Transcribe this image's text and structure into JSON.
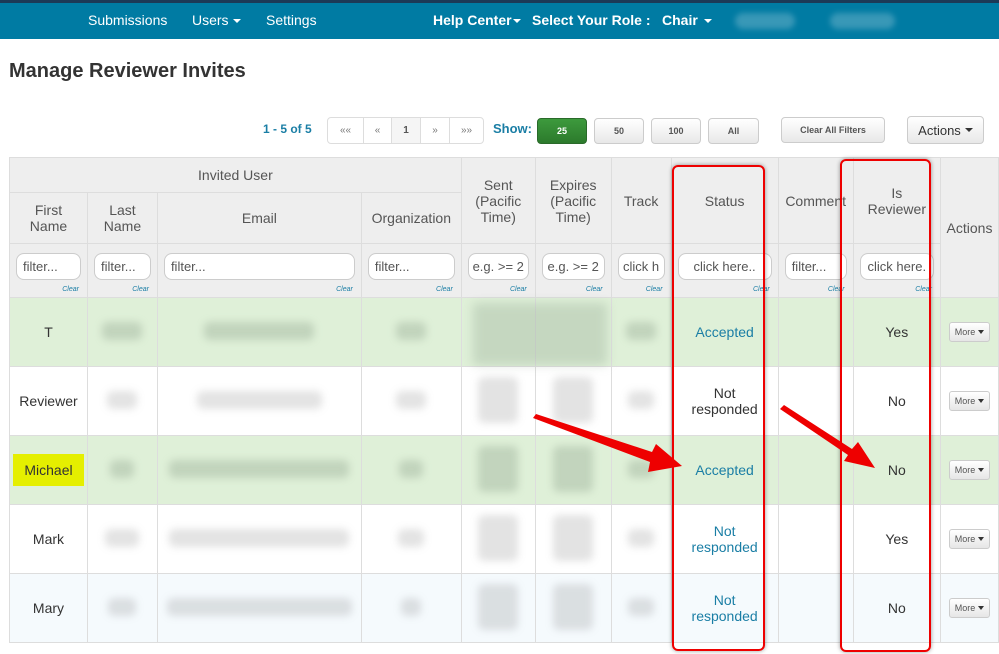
{
  "nav": {
    "submissions": "Submissions",
    "users": "Users",
    "settings": "Settings",
    "help_center": "Help Center",
    "select_role_label": "Select Your Role :",
    "role": "Chair"
  },
  "page_title": "Manage Reviewer Invites",
  "pagination": {
    "info": "1 - 5 of 5",
    "first": "««",
    "prev": "«",
    "current": "1",
    "next": "»",
    "last": "»»"
  },
  "show": {
    "label": "Show:",
    "options": [
      "25",
      "50",
      "100",
      "All"
    ],
    "selected": "25"
  },
  "toolbar": {
    "clear_filters": "Clear All Filters",
    "actions": "Actions"
  },
  "table": {
    "group_header": "Invited User",
    "columns": {
      "first_name": "First Name",
      "last_name": "Last Name",
      "email": "Email",
      "organization": "Organization",
      "sent": "Sent (Pacific Time)",
      "expires": "Expires (Pacific Time)",
      "track": "Track",
      "status": "Status",
      "comment": "Comment",
      "is_reviewer": "Is Reviewer",
      "actions": "Actions"
    },
    "filters": {
      "first_name": "filter...",
      "last_name": "filter...",
      "email": "filter...",
      "organization": "filter...",
      "sent": "e.g. >= 2",
      "expires": "e.g. >= 2",
      "track": "click h",
      "status": "click here..",
      "comment": "filter...",
      "is_reviewer": "click here."
    },
    "clear_label": "Clear",
    "more_label": "More",
    "rows": [
      {
        "first_name": "T",
        "status": "Accepted",
        "is_reviewer": "Yes"
      },
      {
        "first_name": "Reviewer",
        "status": "Not responded",
        "is_reviewer": "No"
      },
      {
        "first_name": "Michael",
        "status": "Accepted",
        "is_reviewer": "No"
      },
      {
        "first_name": "Mark",
        "status": "Not responded",
        "is_reviewer": "Yes"
      },
      {
        "first_name": "Mary",
        "status": "Not responded",
        "is_reviewer": "No"
      }
    ]
  }
}
